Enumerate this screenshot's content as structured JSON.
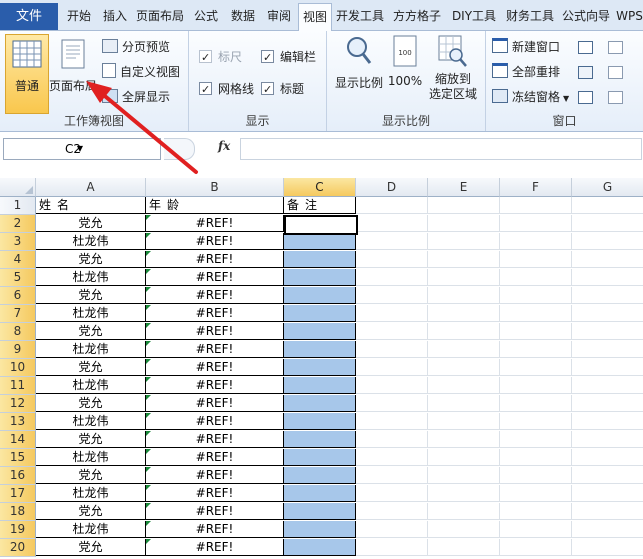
{
  "tabs": [
    "文件",
    "开始",
    "插入",
    "页面布局",
    "公式",
    "数据",
    "审阅",
    "视图",
    "开发工具",
    "方方格子",
    "DIY工具",
    "财务工具",
    "公式向导",
    "WPS"
  ],
  "active_tab": "视图",
  "ribbon": {
    "workbook_views": {
      "label": "工作簿视图",
      "normal": "普通",
      "page_layout": "页面布局",
      "page_break_preview": "分页预览",
      "custom_views": "自定义视图",
      "full_screen": "全屏显示"
    },
    "show": {
      "label": "显示",
      "ruler": "标尺",
      "formula_bar": "编辑栏",
      "gridlines": "网格线",
      "headings": "标题"
    },
    "zoom": {
      "label": "显示比例",
      "zoom": "显示比例",
      "zoom_100": "100%",
      "zoom_to_selection": "缩放到\n选定区域"
    },
    "window": {
      "label": "窗口",
      "new_window": "新建窗口",
      "arrange_all": "全部重排",
      "freeze_panes": "冻结窗格"
    }
  },
  "formula_bar": {
    "name_box": "C2",
    "fx": "fx",
    "content": ""
  },
  "columns": [
    "A",
    "B",
    "C",
    "D",
    "E",
    "F",
    "G"
  ],
  "selected_column": "C",
  "headers_row": {
    "A": "姓名",
    "B": "年龄",
    "C": "备注"
  },
  "rows": [
    {
      "n": "1"
    },
    {
      "n": "2",
      "a": "党允",
      "b": "#REF!"
    },
    {
      "n": "3",
      "a": "杜龙伟",
      "b": "#REF!"
    },
    {
      "n": "4",
      "a": "党允",
      "b": "#REF!"
    },
    {
      "n": "5",
      "a": "杜龙伟",
      "b": "#REF!"
    },
    {
      "n": "6",
      "a": "党允",
      "b": "#REF!"
    },
    {
      "n": "7",
      "a": "杜龙伟",
      "b": "#REF!"
    },
    {
      "n": "8",
      "a": "党允",
      "b": "#REF!"
    },
    {
      "n": "9",
      "a": "杜龙伟",
      "b": "#REF!"
    },
    {
      "n": "10",
      "a": "党允",
      "b": "#REF!"
    },
    {
      "n": "11",
      "a": "杜龙伟",
      "b": "#REF!"
    },
    {
      "n": "12",
      "a": "党允",
      "b": "#REF!"
    },
    {
      "n": "13",
      "a": "杜龙伟",
      "b": "#REF!"
    },
    {
      "n": "14",
      "a": "党允",
      "b": "#REF!"
    },
    {
      "n": "15",
      "a": "杜龙伟",
      "b": "#REF!"
    },
    {
      "n": "16",
      "a": "党允",
      "b": "#REF!"
    },
    {
      "n": "17",
      "a": "杜龙伟",
      "b": "#REF!"
    },
    {
      "n": "18",
      "a": "党允",
      "b": "#REF!"
    },
    {
      "n": "19",
      "a": "杜龙伟",
      "b": "#REF!"
    },
    {
      "n": "20",
      "a": "党允",
      "b": "#REF!"
    }
  ],
  "colors": {
    "file_tab": "#2a5dab",
    "selection": "#a7c7ea",
    "header_selected": "#f5c95f",
    "arrow": "#e02020"
  }
}
